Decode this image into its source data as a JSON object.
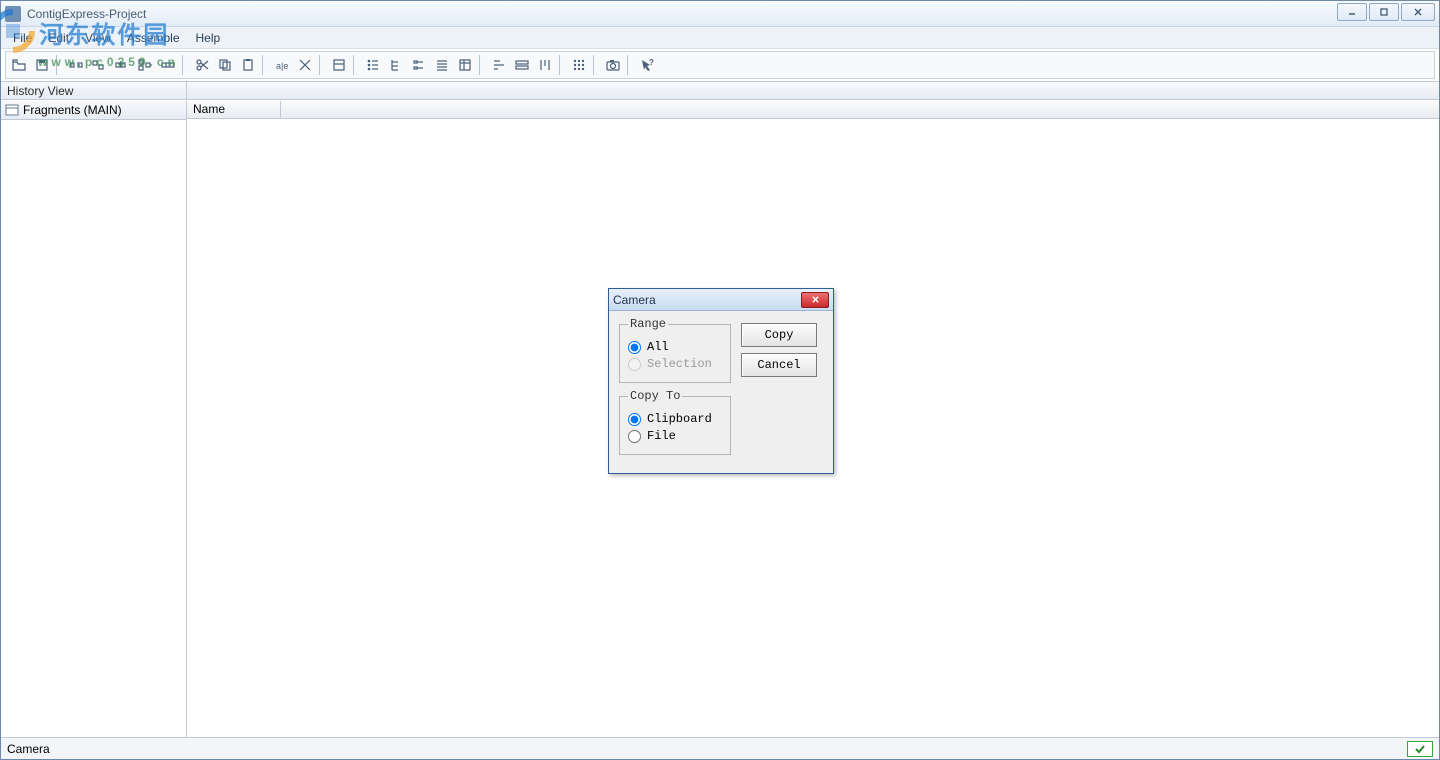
{
  "window": {
    "title": "ContigExpress-Project"
  },
  "menu": [
    "File",
    "Edit",
    "View",
    "Assemble",
    "Help"
  ],
  "panels": {
    "history_header": "History View",
    "right_header": ""
  },
  "sidebar": {
    "fragments_label": "Fragments (MAIN)"
  },
  "columns": [
    "Name"
  ],
  "status": {
    "left": "Camera",
    "right": "✓"
  },
  "dialog": {
    "title": "Camera",
    "group_range": {
      "legend": "Range",
      "opt_all": "All",
      "opt_selection": "Selection"
    },
    "group_copyto": {
      "legend": "Copy To",
      "opt_clipboard": "Clipboard",
      "opt_file": "File"
    },
    "btn_copy": "Copy",
    "btn_cancel": "Cancel"
  },
  "watermark": {
    "brand": "河东软件园",
    "sub": "www.pc0359.cn"
  },
  "toolbar_icons": [
    "open-folder-icon",
    "save-icon",
    "sep",
    "assemble-1-icon",
    "assemble-2-icon",
    "assemble-3-icon",
    "assemble-4-icon",
    "assemble-5-icon",
    "sep",
    "scissors-icon",
    "copy-icon",
    "paste-icon",
    "sep",
    "rename-icon",
    "delete-icon",
    "sep",
    "props-icon",
    "sep",
    "tree-small-icon",
    "tree-med-icon",
    "tree-large-icon",
    "list-icon",
    "details-icon",
    "sep",
    "align-left-icon",
    "align-seq-icon",
    "align-vert-icon",
    "sep",
    "grid-icon",
    "sep",
    "camera-icon",
    "sep",
    "whatsthis-icon"
  ]
}
